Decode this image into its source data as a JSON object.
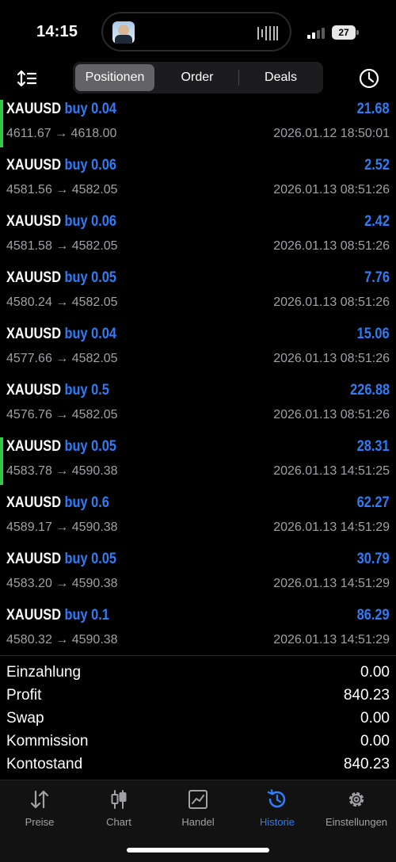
{
  "status": {
    "time": "14:15",
    "battery": "27"
  },
  "toolbar": {
    "tabs": [
      {
        "label": "Positionen"
      },
      {
        "label": "Order"
      },
      {
        "label": "Deals"
      }
    ]
  },
  "positions": [
    {
      "symbol": "XAUUSD",
      "side": "buy 0.04",
      "price": "4611.67 → 4618.00",
      "profit": "21.68",
      "date": "2026.01.12 18:50:01"
    },
    {
      "symbol": "XAUUSD",
      "side": "buy 0.06",
      "price": "4581.56 → 4582.05",
      "profit": "2.52",
      "date": "2026.01.13 08:51:26"
    },
    {
      "symbol": "XAUUSD",
      "side": "buy 0.06",
      "price": "4581.58 → 4582.05",
      "profit": "2.42",
      "date": "2026.01.13 08:51:26"
    },
    {
      "symbol": "XAUUSD",
      "side": "buy 0.05",
      "price": "4580.24 → 4582.05",
      "profit": "7.76",
      "date": "2026.01.13 08:51:26"
    },
    {
      "symbol": "XAUUSD",
      "side": "buy 0.04",
      "price": "4577.66 → 4582.05",
      "profit": "15.06",
      "date": "2026.01.13 08:51:26"
    },
    {
      "symbol": "XAUUSD",
      "side": "buy 0.5",
      "price": "4576.76 → 4582.05",
      "profit": "226.88",
      "date": "2026.01.13 08:51:26"
    },
    {
      "symbol": "XAUUSD",
      "side": "buy 0.05",
      "price": "4583.78 → 4590.38",
      "profit": "28.31",
      "date": "2026.01.13 14:51:25"
    },
    {
      "symbol": "XAUUSD",
      "side": "buy 0.6",
      "price": "4589.17 → 4590.38",
      "profit": "62.27",
      "date": "2026.01.13 14:51:29"
    },
    {
      "symbol": "XAUUSD",
      "side": "buy 0.05",
      "price": "4583.20 → 4590.38",
      "profit": "30.79",
      "date": "2026.01.13 14:51:29"
    },
    {
      "symbol": "XAUUSD",
      "side": "buy 0.1",
      "price": "4580.32 → 4590.38",
      "profit": "86.29",
      "date": "2026.01.13 14:51:29"
    }
  ],
  "summary": [
    {
      "label": "Einzahlung",
      "value": "0.00"
    },
    {
      "label": "Profit",
      "value": "840.23"
    },
    {
      "label": "Swap",
      "value": "0.00"
    },
    {
      "label": "Kommission",
      "value": "0.00"
    },
    {
      "label": "Kontostand",
      "value": "840.23"
    }
  ],
  "tabbar": [
    {
      "label": "Preise",
      "icon": "quotes-icon"
    },
    {
      "label": "Chart",
      "icon": "candlestick-icon"
    },
    {
      "label": "Handel",
      "icon": "trade-chart-icon"
    },
    {
      "label": "Historie",
      "icon": "history-icon"
    },
    {
      "label": "Einstellungen",
      "icon": "gear-icon"
    }
  ],
  "colors": {
    "accent": "#2f7cf6",
    "highlight_bar": "#30c94a",
    "muted": "#a1a1a6",
    "background": "#000000"
  }
}
